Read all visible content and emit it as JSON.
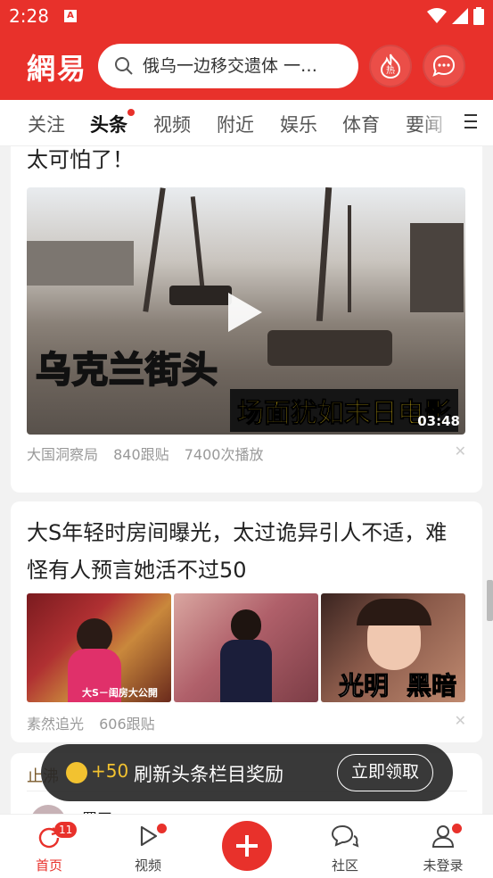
{
  "status_bar": {
    "time": "2:28",
    "notification_icon": "A"
  },
  "header": {
    "logo": "網易",
    "search_placeholder": "俄乌一边移交遗体 一…",
    "hot_label": "热"
  },
  "tabs": [
    {
      "label": "关注",
      "active": false
    },
    {
      "label": "头条",
      "active": true,
      "dot": true
    },
    {
      "label": "视频",
      "active": false
    },
    {
      "label": "附近",
      "active": false
    },
    {
      "label": "娱乐",
      "active": false
    },
    {
      "label": "体育",
      "active": false
    },
    {
      "label": "要闻",
      "active": false
    }
  ],
  "feed": {
    "video_card": {
      "title_tail": "太可怕了！",
      "overlay_line1": "乌克兰街头",
      "overlay_line2": "场面犹如末日电影",
      "duration": "03:48",
      "source": "大国洞察局",
      "comments": "840跟贴",
      "plays": "7400次播放"
    },
    "article_card": {
      "title": "大S年轻时房间曝光，太过诡异引人不适，难怪有人预言她活不过50",
      "img1_caption": "大S－闺房大公開",
      "img3_caption_left": "光明",
      "img3_caption_right": "黑暗",
      "source": "素然追光",
      "comments": "606跟贴"
    },
    "partial_card": {
      "tag": "止沸",
      "author_initial": "署王"
    }
  },
  "toast": {
    "reward": "+50",
    "message": "刷新头条栏目奖励",
    "button": "立即领取"
  },
  "bottom_nav": [
    {
      "label": "首页",
      "icon": "refresh-icon",
      "badge": "11",
      "active": true
    },
    {
      "label": "视频",
      "icon": "play-icon",
      "dot": true
    },
    {
      "label": "",
      "icon": "plus-icon"
    },
    {
      "label": "社区",
      "icon": "chat-bubbles-icon"
    },
    {
      "label": "未登录",
      "icon": "user-icon",
      "dot": true
    }
  ],
  "colors": {
    "brand": "#e8312b",
    "coin": "#f2c230"
  }
}
